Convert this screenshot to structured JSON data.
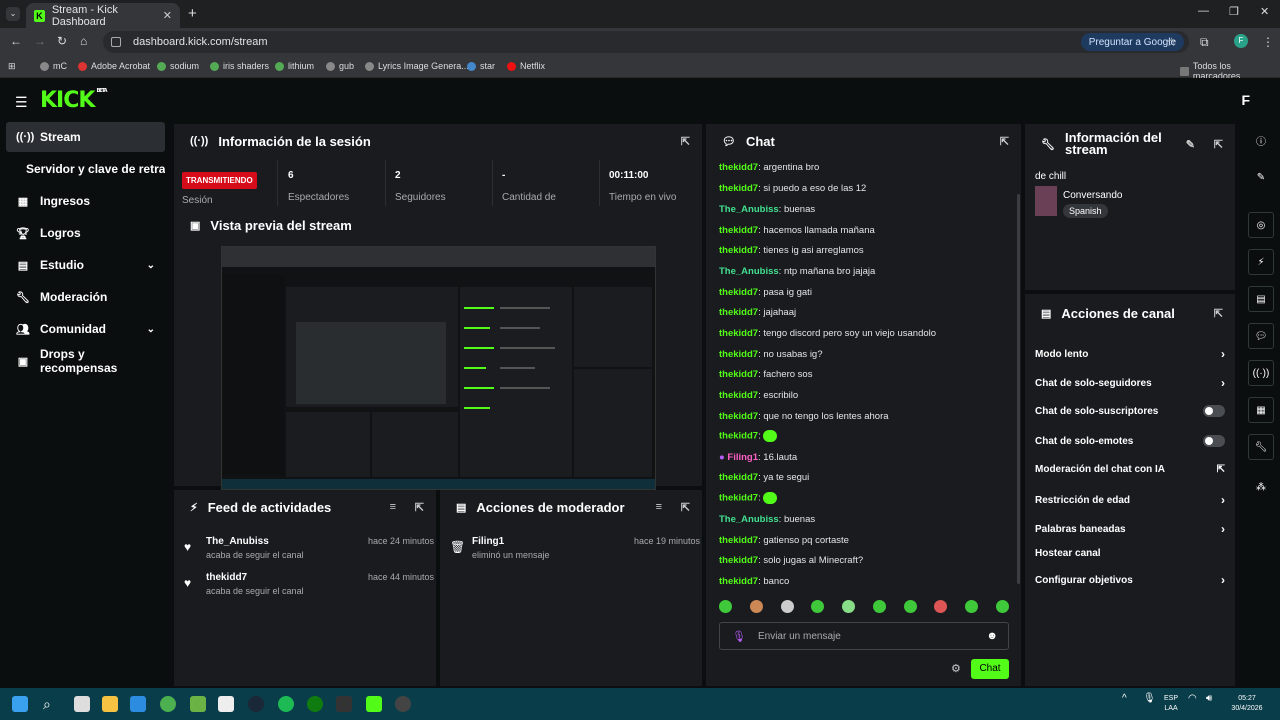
{
  "browser": {
    "tab_title": "Stream - Kick Dashboard",
    "url": "dashboard.kick.com/stream",
    "google_btn": "Preguntar a Google",
    "profile_initial": "F",
    "bookmarks": [
      "mC",
      "Adobe Acrobat",
      "sodium",
      "iris shaders",
      "lithium",
      "gub",
      "Lyrics Image Genera...",
      "star",
      "Netflix"
    ],
    "all_bookmarks": "Todos los marcadores"
  },
  "app": {
    "logo": "KICK",
    "logo_badge": "BETA",
    "top_right": "F"
  },
  "sidebar": {
    "items": [
      {
        "label": "Stream"
      },
      {
        "label": "Servidor y clave de retransmisión"
      },
      {
        "label": "Ingresos"
      },
      {
        "label": "Logros"
      },
      {
        "label": "Estudio"
      },
      {
        "label": "Moderación"
      },
      {
        "label": "Comunidad"
      },
      {
        "label": "Drops y recompensas"
      }
    ]
  },
  "session": {
    "title": "Información de la sesión",
    "live_badge": "TRANSMITIENDO",
    "session_label": "Sesión",
    "stats": [
      {
        "value": "6",
        "label": "Espectadores"
      },
      {
        "value": "2",
        "label": "Seguidores"
      },
      {
        "value": "-",
        "label": "Cantidad de"
      },
      {
        "value": "00:11:00",
        "label": "Tiempo en vivo"
      }
    ]
  },
  "preview": {
    "title": "Vista previa del stream"
  },
  "feed": {
    "title": "Feed de actividades",
    "items": [
      {
        "name": "The_Anubiss",
        "sub": "acaba de seguir el canal",
        "time": "hace 24 minutos"
      },
      {
        "name": "thekidd7",
        "sub": "acaba de seguir el canal",
        "time": "hace 44 minutos"
      }
    ]
  },
  "modactions": {
    "title": "Acciones de moderador",
    "items": [
      {
        "name": "Filing1",
        "sub": "eliminó un mensaje",
        "time": "hace 19 minutos"
      }
    ]
  },
  "chat": {
    "title": "Chat",
    "messages": [
      {
        "user": "thekidd7",
        "text": "argentina bro"
      },
      {
        "user": "thekidd7",
        "text": "si puedo a eso de las 12"
      },
      {
        "user": "The_Anubiss",
        "text": "buenas"
      },
      {
        "user": "thekidd7",
        "text": "hacemos llamada mañana"
      },
      {
        "user": "thekidd7",
        "text": "tienes ig asi arreglamos"
      },
      {
        "user": "The_Anubiss",
        "text": "ntp mañana bro jajaja"
      },
      {
        "user": "thekidd7",
        "text": "pasa ig gati"
      },
      {
        "user": "thekidd7",
        "text": "jajahaaj"
      },
      {
        "user": "thekidd7",
        "text": "tengo discord pero soy un viejo usandolo"
      },
      {
        "user": "thekidd7",
        "text": "no usabas ig?"
      },
      {
        "user": "thekidd7",
        "text": "fachero sos"
      },
      {
        "user": "thekidd7",
        "text": "escribilo"
      },
      {
        "user": "thekidd7",
        "text": "que no tengo los lentes ahora"
      },
      {
        "user": "thekidd7",
        "text": ""
      },
      {
        "user": "Filing1",
        "text": "16.lauta"
      },
      {
        "user": "thekidd7",
        "text": "ya te segui"
      },
      {
        "user": "thekidd7",
        "text": ""
      },
      {
        "user": "The_Anubiss",
        "text": "buenas"
      },
      {
        "user": "thekidd7",
        "text": "gatienso pq cortaste"
      },
      {
        "user": "thekidd7",
        "text": "solo jugas al Minecraft?"
      },
      {
        "user": "thekidd7",
        "text": "banco"
      }
    ],
    "input_placeholder": "Enviar un mensaje",
    "send_label": "Chat"
  },
  "streaminfo": {
    "title": "Información del stream",
    "stream_title": "de chill",
    "category": "Conversando",
    "tag": "Spanish"
  },
  "channel_actions": {
    "title": "Acciones de canal",
    "items": [
      {
        "label": "Modo lento",
        "kind": "arrow"
      },
      {
        "label": "Chat de solo-seguidores",
        "kind": "arrow"
      },
      {
        "label": "Chat de solo-suscriptores",
        "kind": "toggle"
      },
      {
        "label": "Chat de solo-emotes",
        "kind": "toggle"
      },
      {
        "label": "Moderación del chat con IA",
        "kind": "external"
      },
      {
        "label": "Restricción de edad",
        "kind": "arrow"
      },
      {
        "label": "Palabras baneadas",
        "kind": "arrow"
      },
      {
        "label": "Hostear canal",
        "kind": "none"
      },
      {
        "label": "Configurar objetivos",
        "kind": "arrow"
      }
    ]
  },
  "taskbar": {
    "lang": "ESP",
    "lang2": "LAA",
    "time": "05:27",
    "date": "30/4/2026"
  },
  "colors": {
    "accent": "#53fc18",
    "live": "#d70c1a",
    "panel": "#191b1f"
  }
}
